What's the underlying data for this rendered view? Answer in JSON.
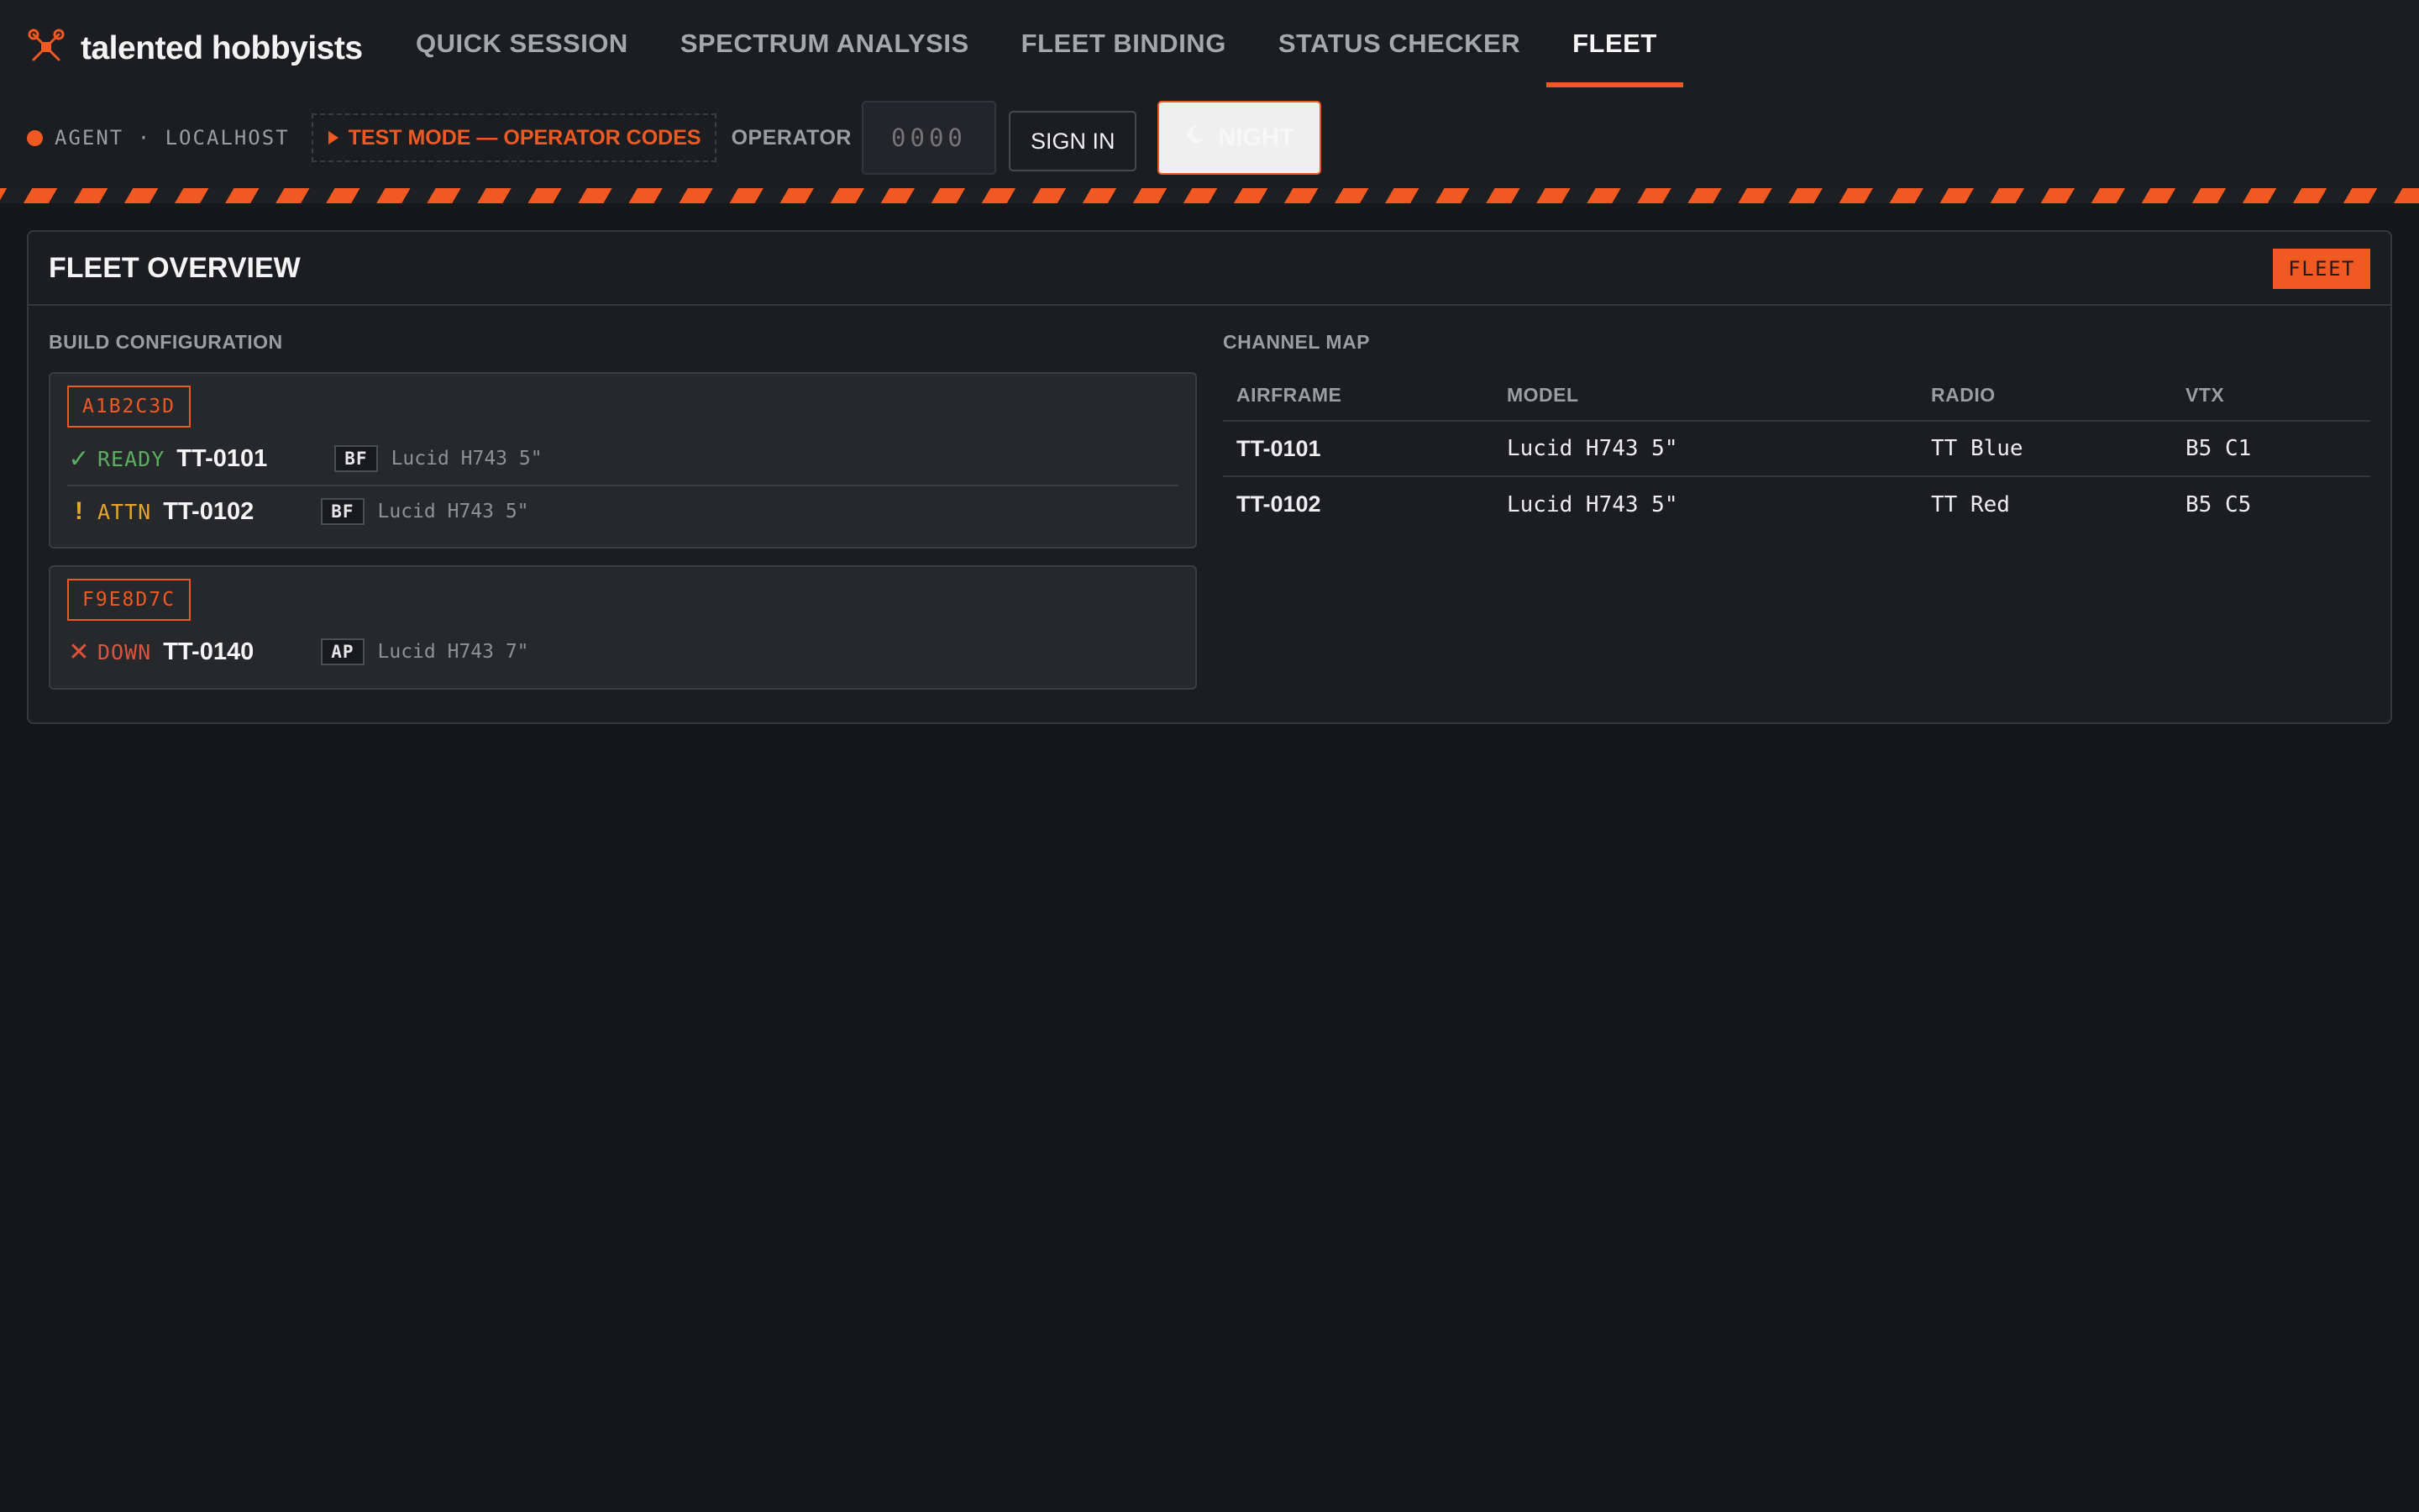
{
  "brand": {
    "name": "talented hobbyists",
    "icon": "drone-icon"
  },
  "nav": {
    "tabs": [
      {
        "label": "QUICK SESSION",
        "active": false
      },
      {
        "label": "SPECTRUM ANALYSIS",
        "active": false
      },
      {
        "label": "FLEET BINDING",
        "active": false
      },
      {
        "label": "STATUS CHECKER",
        "active": false
      },
      {
        "label": "FLEET",
        "active": true
      }
    ]
  },
  "subbar": {
    "agent": "AGENT · LOCALHOST",
    "test_mode": "TEST MODE — OPERATOR CODES",
    "operator_label": "OPERATOR",
    "operator_placeholder": "0000",
    "operator_value": "",
    "sign_in": "SIGN IN",
    "theme": "NIGHT"
  },
  "panel": {
    "title": "FLEET OVERVIEW",
    "badge": "FLEET",
    "build": {
      "label": "BUILD CONFIGURATION",
      "groups": [
        {
          "id": "A1B2C3D",
          "rows": [
            {
              "status_icon": "✓",
              "status": "READY",
              "airframe": "TT-0101",
              "fw": "BF",
              "model": "Lucid H743 5\""
            },
            {
              "status_icon": "!",
              "status": "ATTN",
              "airframe": "TT-0102",
              "fw": "BF",
              "model": "Lucid H743 5\""
            }
          ]
        },
        {
          "id": "F9E8D7C",
          "rows": [
            {
              "status_icon": "✕",
              "status": "DOWN",
              "airframe": "TT-0140",
              "fw": "AP",
              "model": "Lucid H743 7\""
            }
          ]
        }
      ]
    },
    "channel_map": {
      "label": "CHANNEL MAP",
      "columns": [
        "AIRFRAME",
        "MODEL",
        "RADIO",
        "VTX"
      ],
      "rows": [
        [
          "TT-0101",
          "Lucid H743 5\"",
          "TT Blue",
          "B5 C1"
        ],
        [
          "TT-0102",
          "Lucid H743 5\"",
          "TT Red",
          "B5 C5"
        ]
      ]
    }
  },
  "colors": {
    "accent": "#f05a22",
    "ready": "#58b05f",
    "attn": "#e5a52c",
    "down": "#e0533a",
    "background": "#16171a"
  }
}
